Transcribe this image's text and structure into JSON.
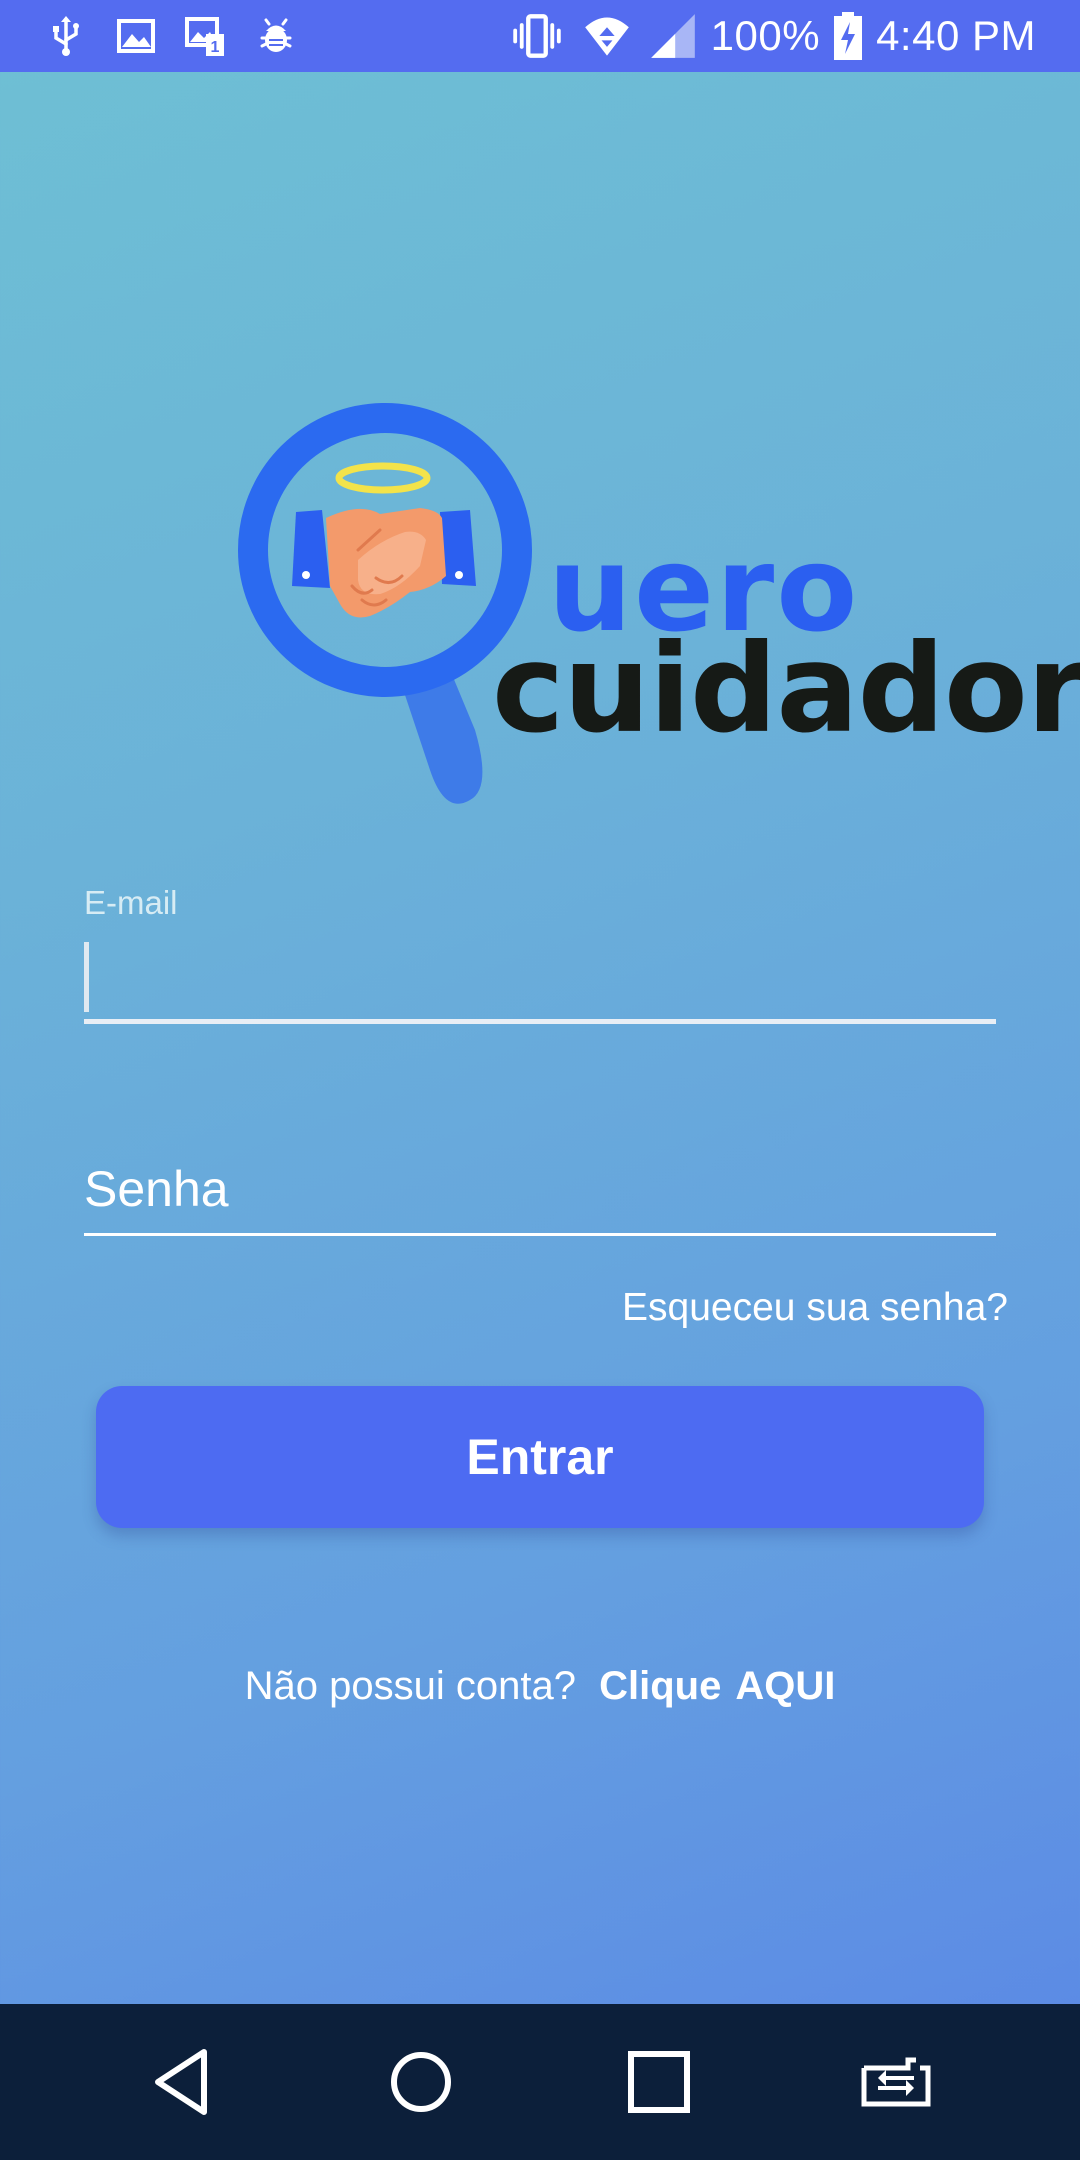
{
  "status_bar": {
    "battery": "100%",
    "time": "4:40 PM",
    "icons_left": [
      "usb-icon",
      "image-icon",
      "sim-notification-icon",
      "android-debug-icon"
    ],
    "icons_right": [
      "vibrate-icon",
      "wifi-icon",
      "signal-icon",
      "battery-charging-icon"
    ]
  },
  "logo": {
    "word_top": "uero",
    "word_bottom": "cuidador",
    "icon": "magnifier-handshake-halo-icon",
    "colors": {
      "blue": "#2b5ff0",
      "dark": "#161a16",
      "halo": "#f3e34a",
      "skin": "#f39a6b"
    }
  },
  "form": {
    "email_label": "E-mail",
    "email_value": "",
    "password_placeholder": "Senha",
    "forgot_password": "Esqueceu sua senha?",
    "login_button": "Entrar"
  },
  "signup": {
    "prompt": "Não possui conta?",
    "link_word1": "Clique",
    "link_word2": "AQUI"
  },
  "nav_bar": {
    "buttons": [
      "back-icon",
      "home-icon",
      "recents-icon",
      "rotate-screen-icon"
    ]
  },
  "colors": {
    "status_bar": "#546cf0",
    "button": "#4d6bf2",
    "nav_bar": "#0c1f3a",
    "background_start": "#6ec0d4",
    "background_end": "#5a86e6"
  }
}
